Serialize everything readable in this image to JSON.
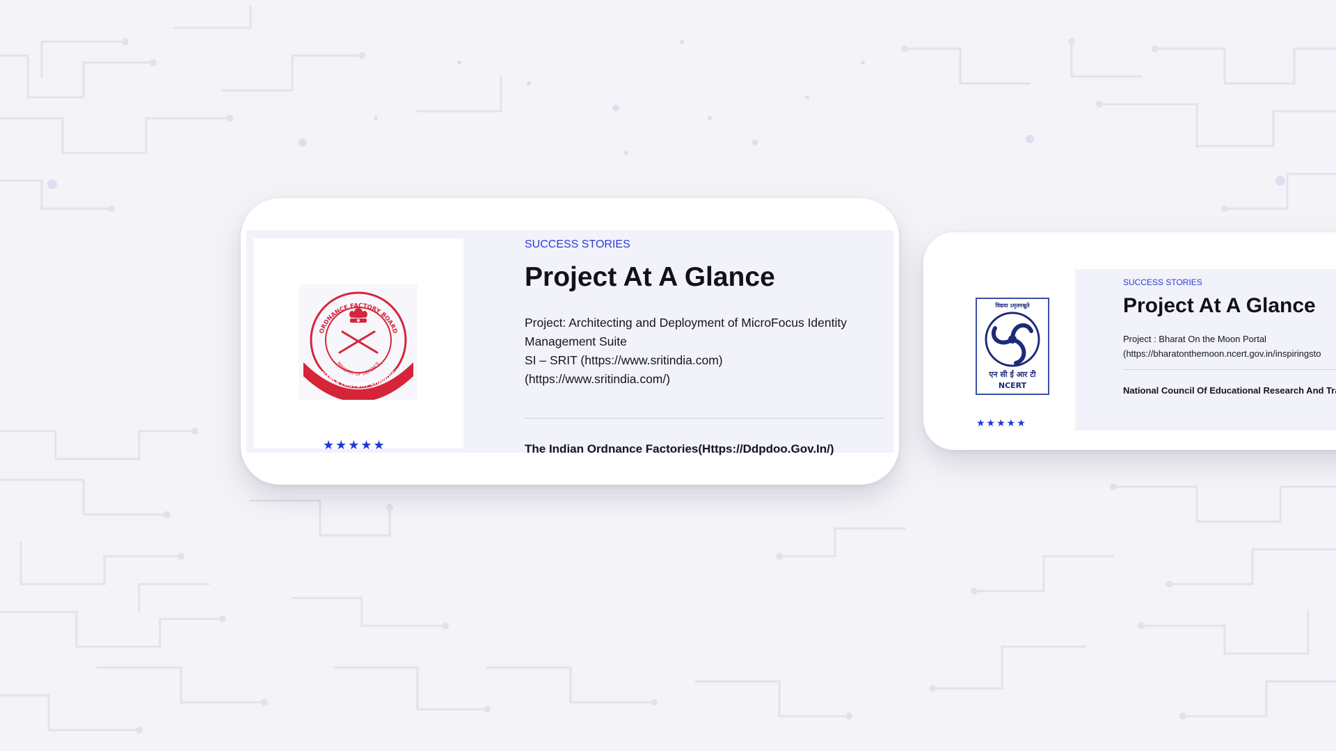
{
  "cards": [
    {
      "eyebrow": "SUCCESS STORIES",
      "title": "Project At A Glance",
      "project_line": "Project: Architecting and Deployment of MicroFocus Identity Management Suite",
      "si_line": "SI – SRIT (https://www.sritindia.com)",
      "si_link": "(https://www.sritindia.com/)",
      "client": "The Indian Ordnance Factories(Https://Ddpdoo.Gov.In/)",
      "stars": "★★★★★",
      "rating": 5,
      "logo": {
        "icon": "ordnance-factory-board-seal-icon",
        "text_top": "ORDNANCE FACTORY BOARD",
        "text_inner": "MINISTRY OF DEFENCE",
        "text_ribbon": "ORDNANCE FACTORY CHANDIGARH",
        "color": "#d6243a"
      }
    },
    {
      "eyebrow": "SUCCESS STORIES",
      "title": "Project At A Glance",
      "project_line": "Project : Bharat On the Moon Portal",
      "url_line": "(https://bharatonthemoon.ncert.gov.in/inspiringsto",
      "client": "National Council Of Educational Research And Tra",
      "stars": "★★★★★",
      "rating": 5,
      "logo": {
        "icon": "ncert-logo-icon",
        "text_top": "विद्यया ऽमृतमश्नुते",
        "text_hindi": "एन सी ई आर टी",
        "text_en": "NCERT",
        "color": "#1e2a78"
      }
    }
  ],
  "colors": {
    "accent": "#2a3bd6",
    "background": "#f4f4f8",
    "panel": "#f2f2fb",
    "circuit": "#e2e3ee"
  }
}
